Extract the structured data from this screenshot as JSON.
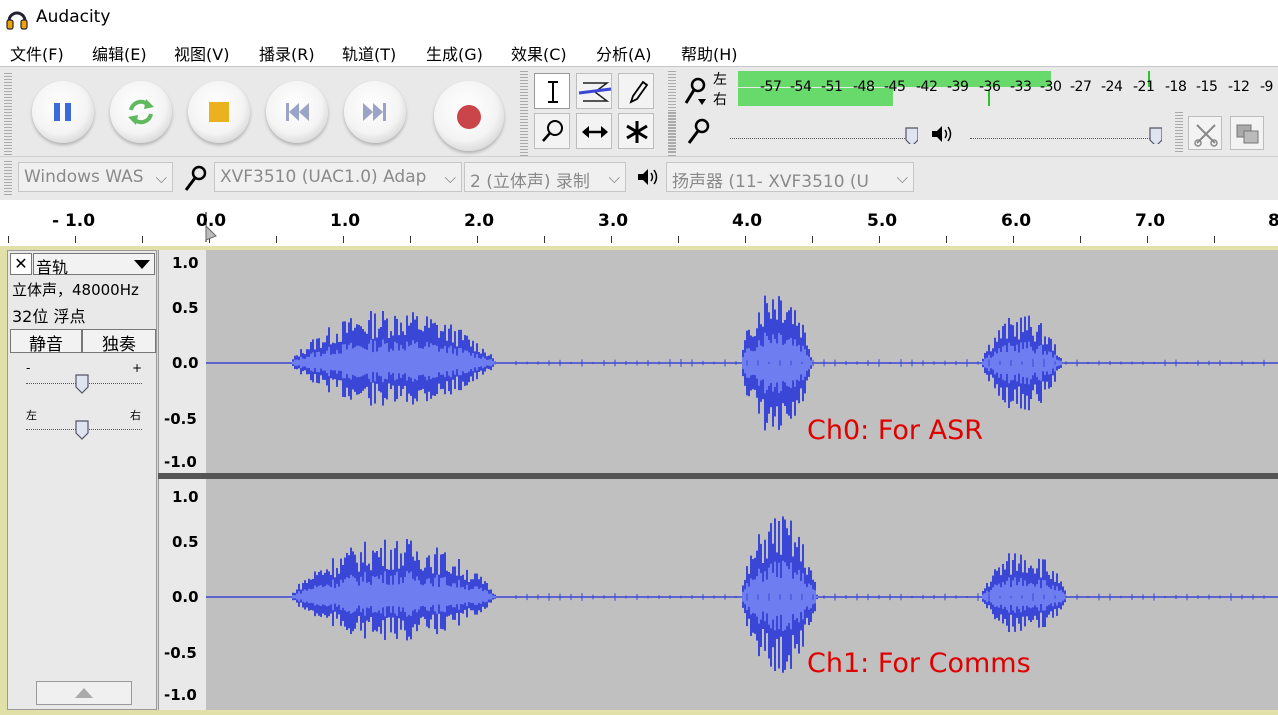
{
  "window": {
    "title": "Audacity"
  },
  "menu": [
    "文件(F)",
    "编辑(E)",
    "视图(V)",
    "播录(R)",
    "轨道(T)",
    "生成(G)",
    "效果(C)",
    "分析(A)",
    "帮助(H)"
  ],
  "transport": {
    "pause_icon": "pause-icon",
    "loop_icon": "loop-icon",
    "stop_icon": "stop-icon",
    "skip_start_icon": "skip-to-start-icon",
    "skip_end_icon": "skip-to-end-icon",
    "record_icon": "record-icon"
  },
  "meters": {
    "record_label_top": "左",
    "record_label_bottom": "右",
    "scale": [
      "-57",
      "-54",
      "-51",
      "-48",
      "-45",
      "-42",
      "-39",
      "-36",
      "-33",
      "-30",
      "-27",
      "-24",
      "-21",
      "-18",
      "-15",
      "-12",
      "-9"
    ],
    "record_level_ch_left_db": -30,
    "record_level_ch_right_db": -45
  },
  "devices": {
    "host": "Windows WAS",
    "input_device": "XVF3510 (UAC1.0) Adap",
    "channels": "2 (立体声) 录制",
    "output_device": "扬声器 (11- XVF3510 (U"
  },
  "ruler": {
    "labels": [
      "- 1.0",
      "0.0",
      "1.0",
      "2.0",
      "3.0",
      "4.0",
      "5.0",
      "6.0",
      "7.0",
      "8"
    ]
  },
  "track": {
    "name": "音轨",
    "format_line1": "立体声，48000Hz",
    "format_line2": "32位 浮点",
    "mute_label": "静音",
    "solo_label": "独奏",
    "gain_minus": "-",
    "gain_plus": "+",
    "pan_left": "左",
    "pan_right": "右"
  },
  "vruler": {
    "labels": [
      "1.0",
      "0.5",
      "0.0",
      "-0.5",
      "-1.0"
    ]
  },
  "annotations": {
    "ch0": "Ch0: For ASR",
    "ch1": "Ch1: For Comms"
  },
  "colors": {
    "waveform": "#3a46d6",
    "waveform_rms": "#6e7ef0",
    "background": "#c0c0c0",
    "annotation": "#e00000",
    "meter": "#68d96b"
  }
}
